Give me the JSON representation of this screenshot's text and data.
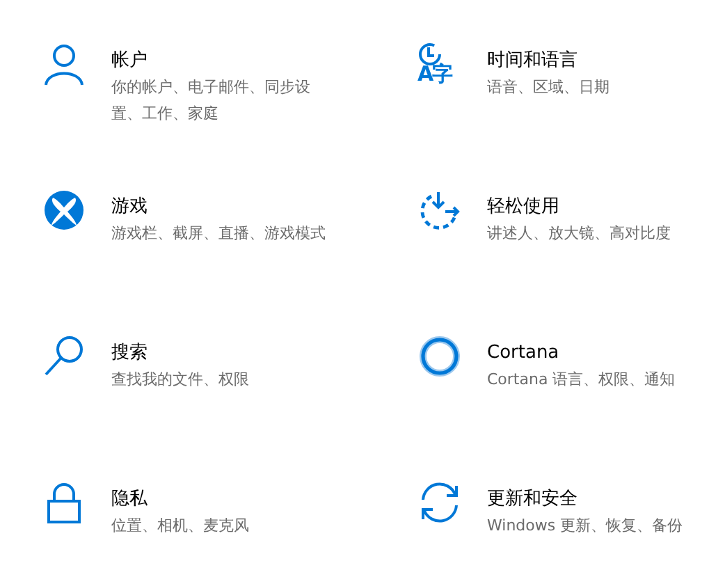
{
  "categories": [
    {
      "kind": "person",
      "title": "帐户",
      "description": "你的帐户、电子邮件、同步设置、工作、家庭"
    },
    {
      "kind": "time-language",
      "glyph": "A字",
      "title": "时间和语言",
      "description": "语音、区域、日期"
    },
    {
      "kind": "xbox",
      "title": "游戏",
      "description": "游戏栏、截屏、直播、游戏模式"
    },
    {
      "kind": "accessibility",
      "title": "轻松使用",
      "description": "讲述人、放大镜、高对比度"
    },
    {
      "kind": "search",
      "title": "搜索",
      "description": "查找我的文件、权限"
    },
    {
      "kind": "cortana",
      "title": "Cortana",
      "description": "Cortana 语言、权限、通知"
    },
    {
      "kind": "lock",
      "title": "隐私",
      "description": "位置、相机、麦克风"
    },
    {
      "kind": "sync",
      "title": "更新和安全",
      "description": "Windows 更新、恢复、备份"
    }
  ]
}
